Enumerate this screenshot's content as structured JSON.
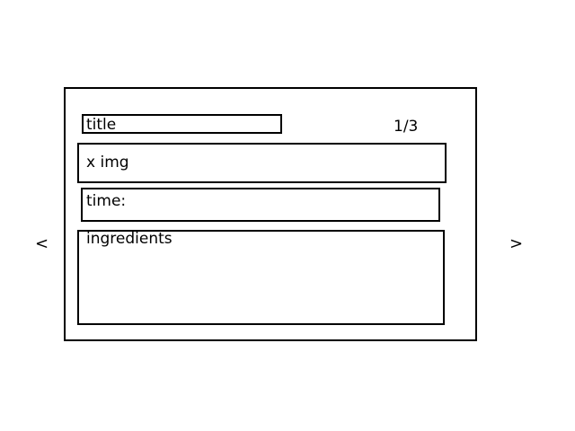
{
  "card": {
    "title_label": "title",
    "image_label": "x img",
    "time_label": "time:",
    "ingredients_label": "ingredients",
    "page_indicator": "1/3"
  },
  "nav": {
    "prev_label": "<",
    "next_label": ">"
  }
}
